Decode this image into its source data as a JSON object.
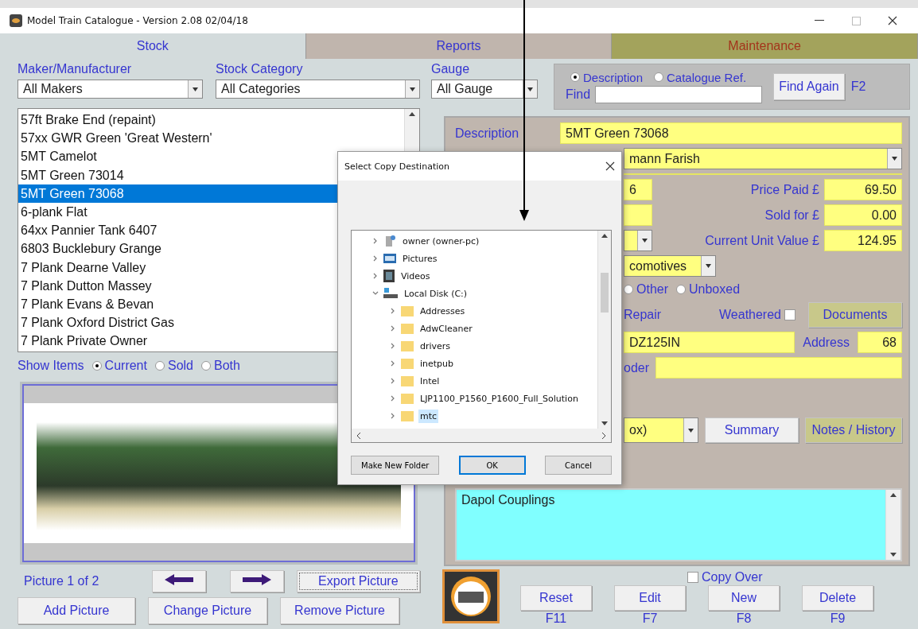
{
  "window": {
    "title": "Model Train Catalogue -  Version 2.08  02/04/18"
  },
  "tabs": [
    {
      "label": "Stock",
      "selected": true
    },
    {
      "label": "Reports",
      "selected": false
    },
    {
      "label": "Maintenance",
      "selected": false
    }
  ],
  "filters": [
    {
      "label": "Maker/Manufacturer",
      "value": "All Makers"
    },
    {
      "label": "Stock Category",
      "value": "All Categories"
    },
    {
      "label": "Gauge",
      "value": "All Gauge"
    }
  ],
  "find": {
    "options": [
      {
        "label": "Description",
        "selected": true
      },
      {
        "label": "Catalogue Ref.",
        "selected": false
      }
    ],
    "label": "Find",
    "button": "Find Again",
    "shortcut": "F2"
  },
  "stock_list": [
    {
      "label": "57ft Brake End (repaint)",
      "selected": false
    },
    {
      "label": "57xx GWR Green 'Great Western'",
      "selected": false
    },
    {
      "label": "5MT Camelot",
      "selected": false
    },
    {
      "label": "5MT Green 73014",
      "selected": false
    },
    {
      "label": "5MT Green 73068",
      "selected": true
    },
    {
      "label": "6-plank Flat",
      "selected": false
    },
    {
      "label": "64xx Pannier Tank 6407",
      "selected": false
    },
    {
      "label": "6803 Bucklebury Grange",
      "selected": false
    },
    {
      "label": "7 Plank Dearne Valley",
      "selected": false
    },
    {
      "label": "7 Plank Dutton Massey",
      "selected": false
    },
    {
      "label": "7 Plank Evans & Bevan",
      "selected": false
    },
    {
      "label": "7 Plank Oxford District Gas",
      "selected": false
    },
    {
      "label": "7 Plank Private Owner",
      "selected": false
    }
  ],
  "show_items": {
    "label": "Show Items",
    "options": [
      {
        "label": "Current",
        "selected": true
      },
      {
        "label": "Sold",
        "selected": false
      },
      {
        "label": "Both",
        "selected": false
      }
    ]
  },
  "picture": {
    "counter": "Picture 1 of 2",
    "export_button": "Export Picture",
    "buttons": [
      "Add Picture",
      "Change Picture",
      "Remove Picture"
    ]
  },
  "details": {
    "description_label": "Description",
    "description": "5MT Green 73068",
    "maker": "mann Farish",
    "price_rows": [
      {
        "kind": "field",
        "field": "6",
        "label": "Price Paid £",
        "value": "69.50"
      },
      {
        "kind": "field",
        "label": "Sold for £",
        "value": "0.00"
      },
      {
        "kind": "dropdown",
        "label": "Current Unit Value £",
        "value": "124.95"
      }
    ],
    "category": "comotives",
    "box_options": [
      {
        "label": "Other",
        "selected": false
      },
      {
        "label": "Unboxed",
        "selected": false
      }
    ],
    "repair_label": "Repair",
    "weathered": {
      "label": "Weathered",
      "checked": false
    },
    "documents_button": "Documents",
    "decoder_code": "DZ125IN",
    "address_label": "Address",
    "address": "68",
    "decoder_label": "oder",
    "packaging": "ox)",
    "summary_button": "Summary",
    "notes_button": "Notes / History",
    "notes": "Dapol Couplings"
  },
  "actions": {
    "copy_over": {
      "label": "Copy Over",
      "checked": false
    },
    "buttons": [
      {
        "label": "Reset",
        "key": "F11"
      },
      {
        "label": "Edit",
        "key": "F7"
      },
      {
        "label": "New",
        "key": "F8"
      },
      {
        "label": "Delete",
        "key": "F9"
      }
    ]
  },
  "dialog": {
    "title": "Select Copy Destination",
    "tree": [
      {
        "kind": "network",
        "label": "owner (owner-pc)",
        "expanded": false,
        "selected": false
      },
      {
        "kind": "pictures",
        "label": "Pictures",
        "expanded": false,
        "selected": false
      },
      {
        "kind": "videos",
        "label": "Videos",
        "expanded": false,
        "selected": false
      },
      {
        "kind": "disk",
        "label": "Local Disk (C:)",
        "expanded": true,
        "selected": false,
        "children": [
          {
            "kind": "folder",
            "label": "Addresses",
            "expanded": false,
            "selected": false
          },
          {
            "kind": "folder",
            "label": "AdwCleaner",
            "expanded": false,
            "selected": false
          },
          {
            "kind": "folder",
            "label": "drivers",
            "expanded": false,
            "selected": false
          },
          {
            "kind": "folder",
            "label": "inetpub",
            "expanded": false,
            "selected": false
          },
          {
            "kind": "folder",
            "label": "Intel",
            "expanded": false,
            "selected": false
          },
          {
            "kind": "folder",
            "label": "LJP1100_P1560_P1600_Full_Solution",
            "expanded": false,
            "selected": false
          },
          {
            "kind": "folder",
            "label": "mtc",
            "expanded": false,
            "selected": true
          }
        ]
      }
    ],
    "buttons": [
      "Make New Folder",
      "OK",
      "Cancel"
    ]
  }
}
